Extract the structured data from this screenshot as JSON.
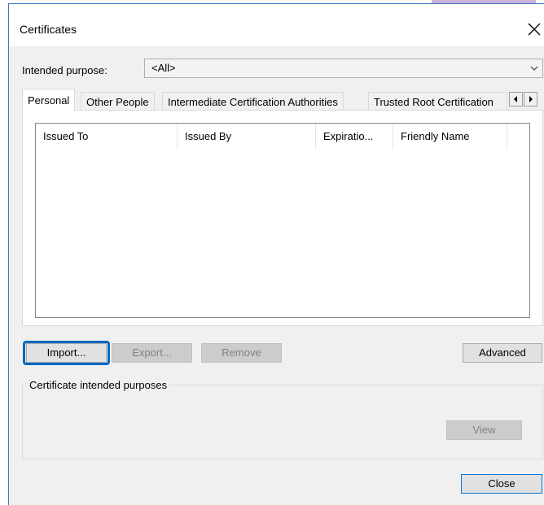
{
  "window": {
    "title": "Certificates"
  },
  "purpose": {
    "label": "Intended purpose:",
    "value": "<All>"
  },
  "tabs": [
    {
      "label": "Personal",
      "active": true
    },
    {
      "label": "Other People",
      "active": false
    },
    {
      "label": "Intermediate Certification Authorities",
      "active": false
    },
    {
      "label": "Trusted Root Certification",
      "active": false
    }
  ],
  "list": {
    "columns": [
      "Issued To",
      "Issued By",
      "Expiratio...",
      "Friendly Name"
    ]
  },
  "buttons": {
    "import": "Import...",
    "export": "Export...",
    "remove": "Remove",
    "advanced": "Advanced",
    "view": "View",
    "close": "Close"
  },
  "group": {
    "label": "Certificate intended purposes"
  },
  "icons": {
    "close": "close-icon",
    "dropdown": "chevron-down-icon",
    "scroll_left": "triangle-left-icon",
    "scroll_right": "triangle-right-icon"
  },
  "colors": {
    "accent": "#0078d7",
    "focus": "#0067c0"
  }
}
